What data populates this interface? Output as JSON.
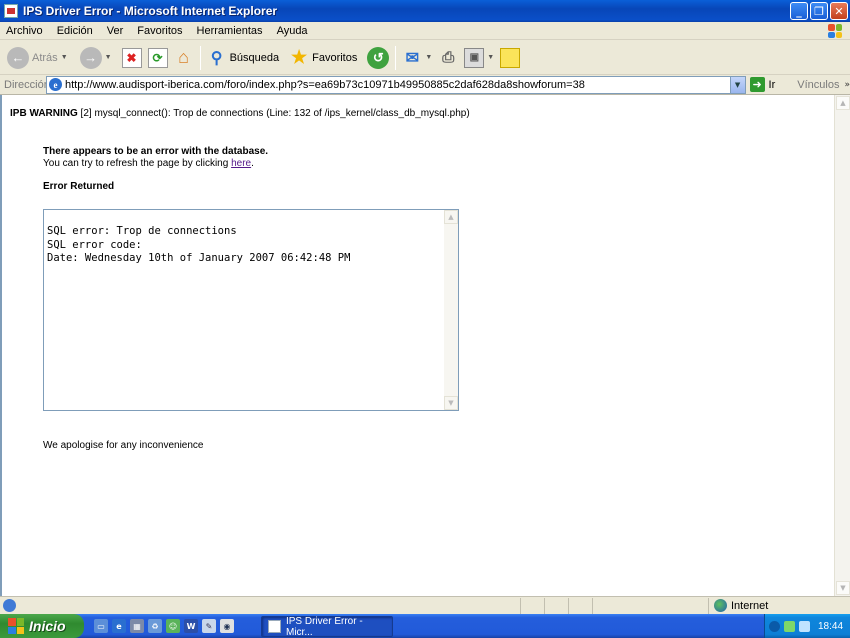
{
  "window": {
    "title": "IPS Driver Error - Microsoft Internet Explorer",
    "minimize": "_",
    "maximize": "❐",
    "close": "✕"
  },
  "menu": [
    "Archivo",
    "Edición",
    "Ver",
    "Favoritos",
    "Herramientas",
    "Ayuda"
  ],
  "toolbar": {
    "back": "Atrás",
    "search": "Búsqueda",
    "favorites": "Favoritos"
  },
  "address": {
    "label": "Dirección",
    "url": "http://www.audisport-iberica.com/foro/index.php?s=ea69b73c10971b49950885c2daf628da8showforum=38",
    "go": "Ir",
    "links": "Vínculos"
  },
  "page": {
    "warning_label": "IPB WARNING",
    "warning_text": " [2] mysql_connect(): Trop de connections (Line: 132 of /ips_kernel/class_db_mysql.php)",
    "error_heading": "There appears to be an error with the database.",
    "refresh_prefix": "You can try to refresh the page by clicking ",
    "refresh_link": "here",
    "refresh_suffix": ".",
    "error_returned": "Error Returned",
    "sql_lines": [
      "SQL error: Trop de connections",
      "SQL error code:",
      "Date: Wednesday 10th of January 2007 06:42:48 PM"
    ],
    "apology": "We apologise for any inconvenience"
  },
  "status": {
    "zone": "Internet"
  },
  "taskbar": {
    "start": "Inicio",
    "task_label": "IPS Driver Error - Micr...",
    "clock": "18:44"
  },
  "colors": {
    "titlebar": "#0a4fc8",
    "taskbar": "#245edc",
    "start": "#2f8a2f",
    "link_visited": "#551a8b"
  }
}
